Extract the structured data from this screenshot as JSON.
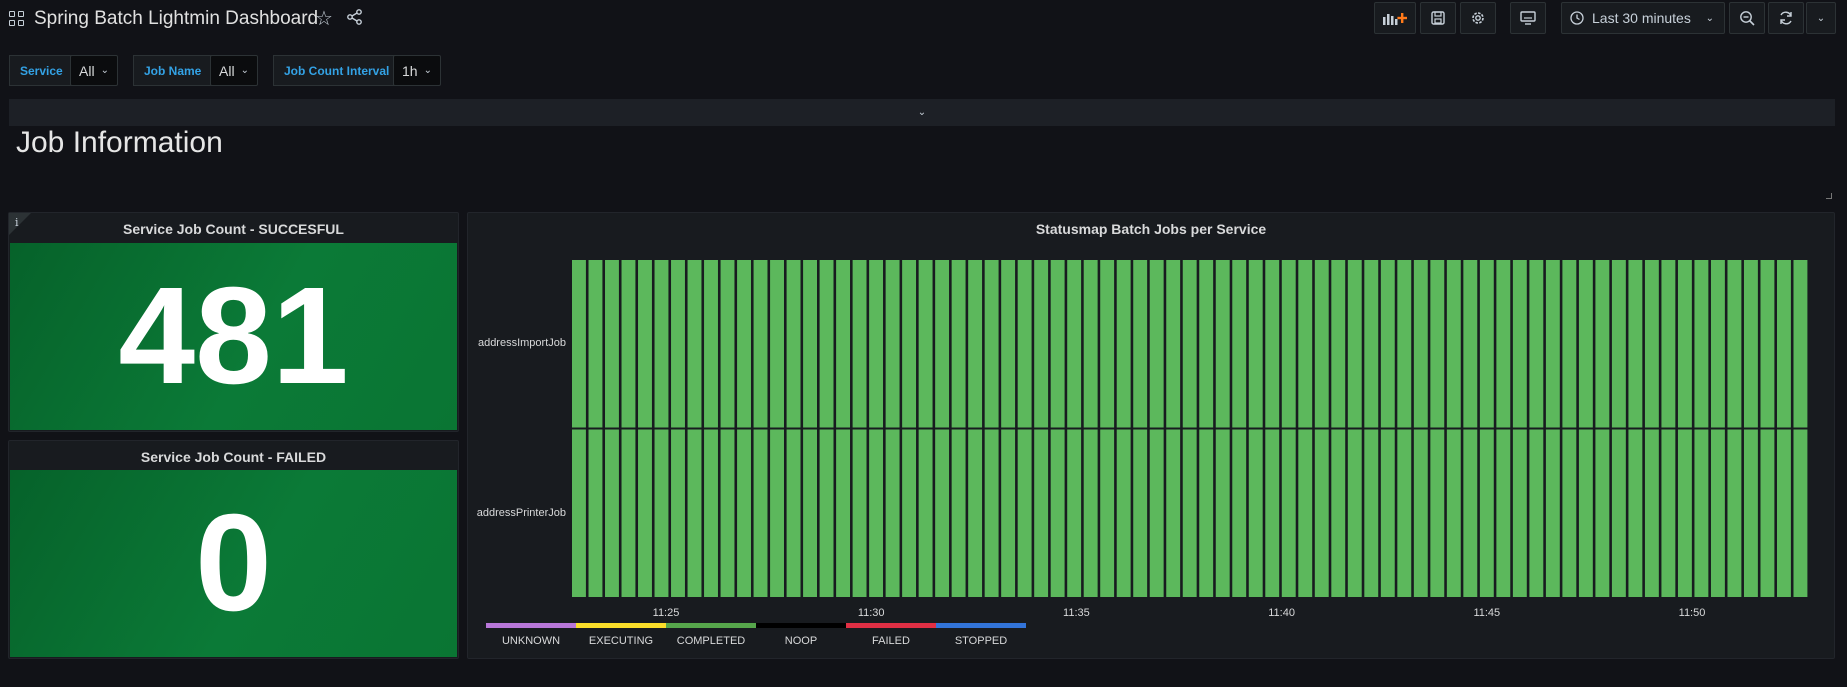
{
  "header": {
    "title": "Spring Batch Lightmin Dashboard",
    "time_range": "Last 30 minutes"
  },
  "icons": [
    "apps-icon",
    "star-icon",
    "share-icon",
    "add-panel-icon",
    "save-icon",
    "gear-icon",
    "tv-icon",
    "clock-icon",
    "chevron-down-icon",
    "zoom-out-icon",
    "refresh-icon"
  ],
  "variables": [
    {
      "label": "Service",
      "value": "All"
    },
    {
      "label": "Job Name",
      "value": "All"
    },
    {
      "label": "Job Count Interval",
      "value": "1h"
    }
  ],
  "row": {
    "title": "Job Information"
  },
  "panels": {
    "success": {
      "title": "Service Job Count - SUCCESFUL",
      "value": "481"
    },
    "failed": {
      "title": "Service Job Count - FAILED",
      "value": "0"
    },
    "statusmap": {
      "title": "Statusmap Batch Jobs per Service"
    }
  },
  "chart_data": {
    "type": "heatmap",
    "title": "Statusmap Batch Jobs per Service",
    "rows": [
      "addressImportJob",
      "addressPrinterJob"
    ],
    "x_ticks": [
      "11:25",
      "11:30",
      "11:35",
      "11:40",
      "11:45",
      "11:50"
    ],
    "bucket_count": 75,
    "cell_status": "COMPLETED",
    "legend": [
      {
        "label": "UNKNOWN",
        "color": "#b877d9"
      },
      {
        "label": "EXECUTING",
        "color": "#fade2a"
      },
      {
        "label": "COMPLETED",
        "color": "#56a64b"
      },
      {
        "label": "NOOP",
        "color": "#000000"
      },
      {
        "label": "FAILED",
        "color": "#e02f44"
      },
      {
        "label": "STOPPED",
        "color": "#3274d9"
      }
    ],
    "colors": {
      "completed_cell": "#5cb85c"
    }
  }
}
